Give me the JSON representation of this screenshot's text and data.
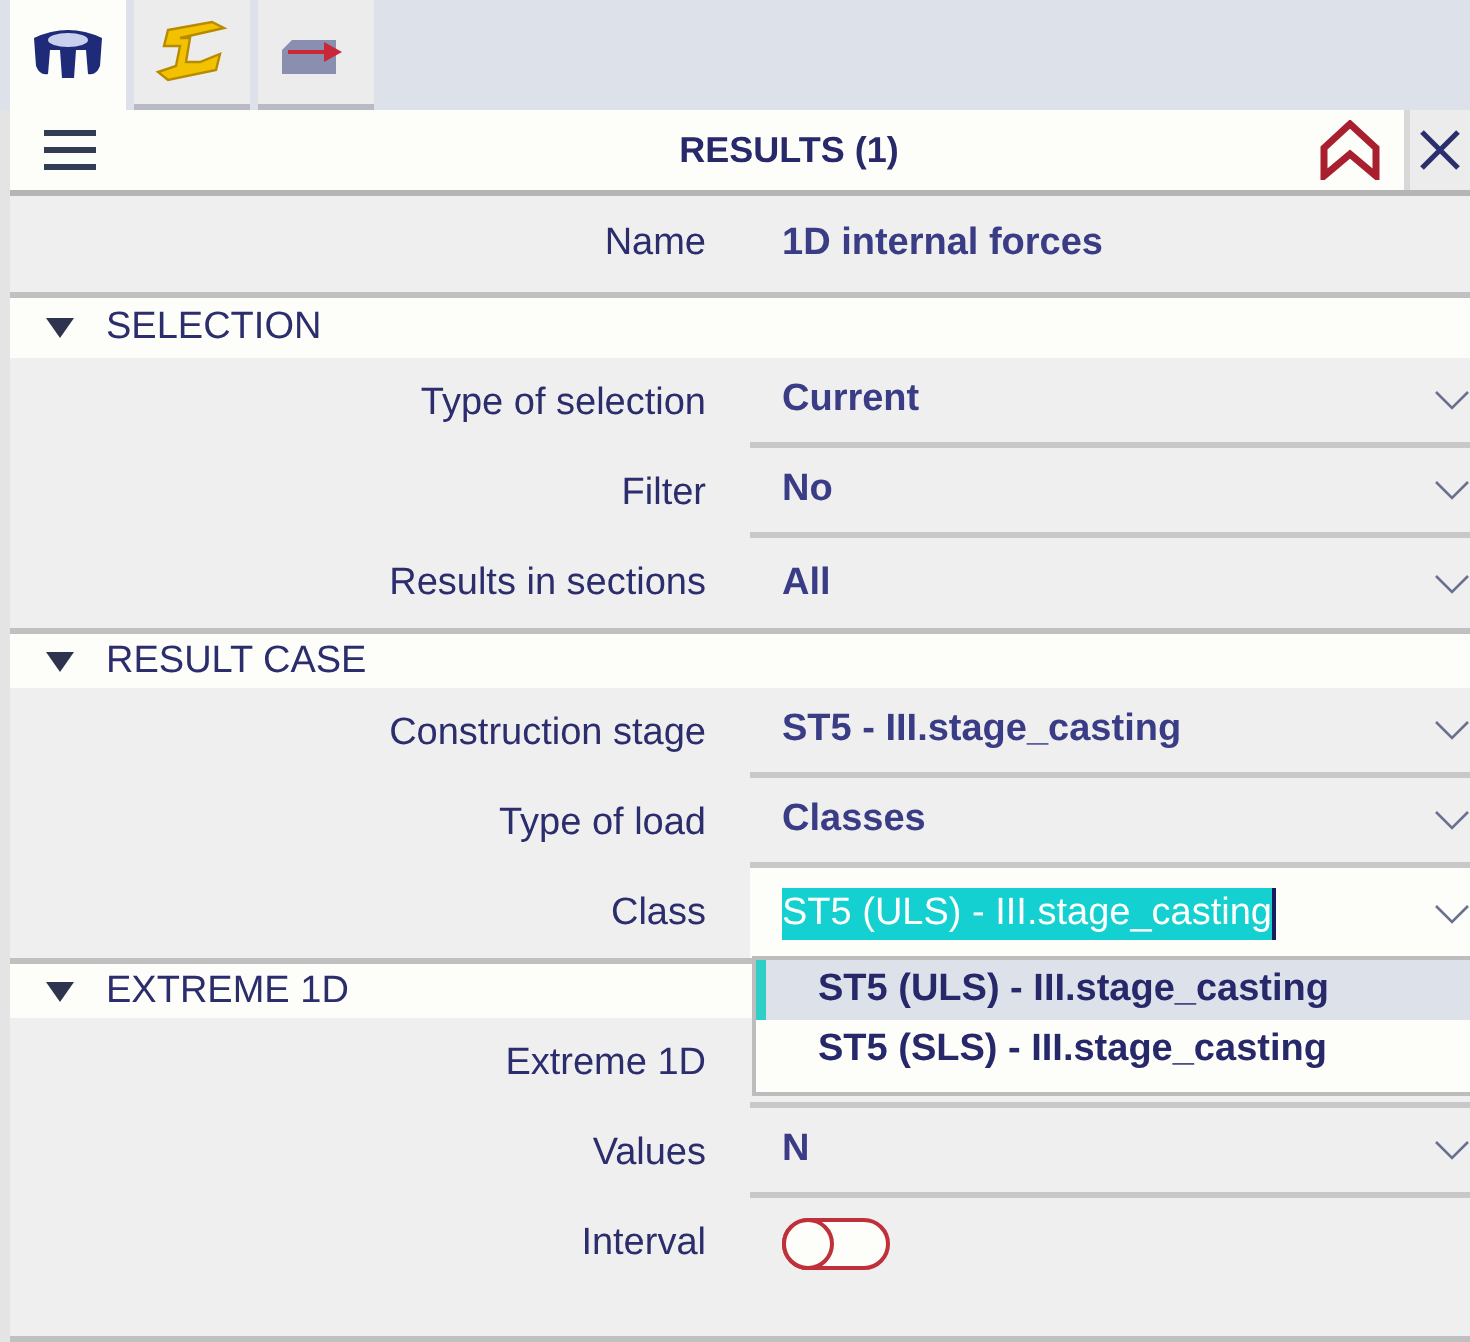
{
  "tabs": [
    {
      "kind": "support",
      "selected": true
    },
    {
      "kind": "beam",
      "selected": false
    },
    {
      "kind": "load",
      "selected": false
    }
  ],
  "panel": {
    "title": "RESULTS (1)",
    "name_label": "Name",
    "name_value": "1D internal forces"
  },
  "sections": [
    {
      "title": "SELECTION",
      "expanded": true,
      "rows": [
        {
          "label": "Type of selection",
          "kind": "dropdown",
          "value": "Current"
        },
        {
          "label": "Filter",
          "kind": "dropdown",
          "value": "No"
        },
        {
          "label": "Results in sections",
          "kind": "dropdown",
          "value": "All"
        }
      ]
    },
    {
      "title": "RESULT CASE",
      "expanded": true,
      "rows": [
        {
          "label": "Construction stage",
          "kind": "dropdown",
          "value": "ST5 - III.stage_casting"
        },
        {
          "label": "Type of load",
          "kind": "dropdown",
          "value": "Classes"
        },
        {
          "label": "Class",
          "kind": "dropdown",
          "value": "ST5 (ULS) - III.stage_casting",
          "open": true,
          "options": [
            {
              "label": "ST5 (ULS) - III.stage_casting",
              "selected": true
            },
            {
              "label": "ST5 (SLS) - III.stage_casting",
              "selected": false
            }
          ]
        }
      ]
    },
    {
      "title": "EXTREME 1D",
      "expanded": true,
      "rows": [
        {
          "label": "Extreme 1D",
          "kind": "dropdown"
        },
        {
          "label": "Values",
          "kind": "dropdown",
          "value": "N"
        },
        {
          "label": "Interval",
          "kind": "toggle",
          "on": false
        }
      ]
    }
  ]
}
